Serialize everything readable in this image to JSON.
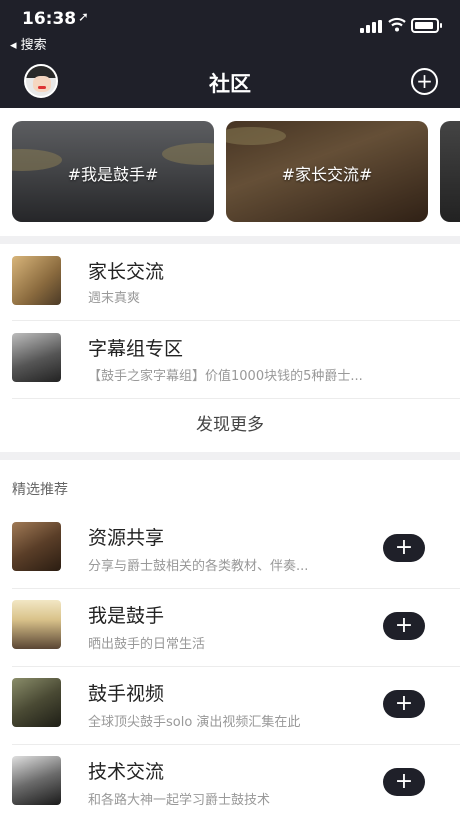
{
  "status_bar": {
    "time": "16:38",
    "location_arrow": "➚",
    "back_label": "◂ 搜索"
  },
  "nav": {
    "title": "社区",
    "add_icon": "+"
  },
  "banners": [
    {
      "tag": "#我是鼓手#"
    },
    {
      "tag": "#家长交流#"
    }
  ],
  "joined": [
    {
      "title": "家长交流",
      "subtitle": "週末真爽"
    },
    {
      "title": "字幕组专区",
      "subtitle": "【鼓手之家字幕组】价值1000块钱的5种爵士..."
    }
  ],
  "more_label": "发现更多",
  "section_title": "精选推荐",
  "recommended": [
    {
      "title": "资源共享",
      "subtitle": "分享与爵士鼓相关的各类教材、伴奏..."
    },
    {
      "title": "我是鼓手",
      "subtitle": "晒出鼓手的日常生活"
    },
    {
      "title": "鼓手视频",
      "subtitle": "全球顶尖鼓手solo 演出视频汇集在此"
    },
    {
      "title": "技术交流",
      "subtitle": "和各路大神一起学习爵士鼓技术"
    }
  ],
  "join_icon": "+",
  "colors": {
    "header_bg": "#1f2029",
    "accent_button": "#1f2029",
    "divider_band": "#f0f0f2"
  }
}
